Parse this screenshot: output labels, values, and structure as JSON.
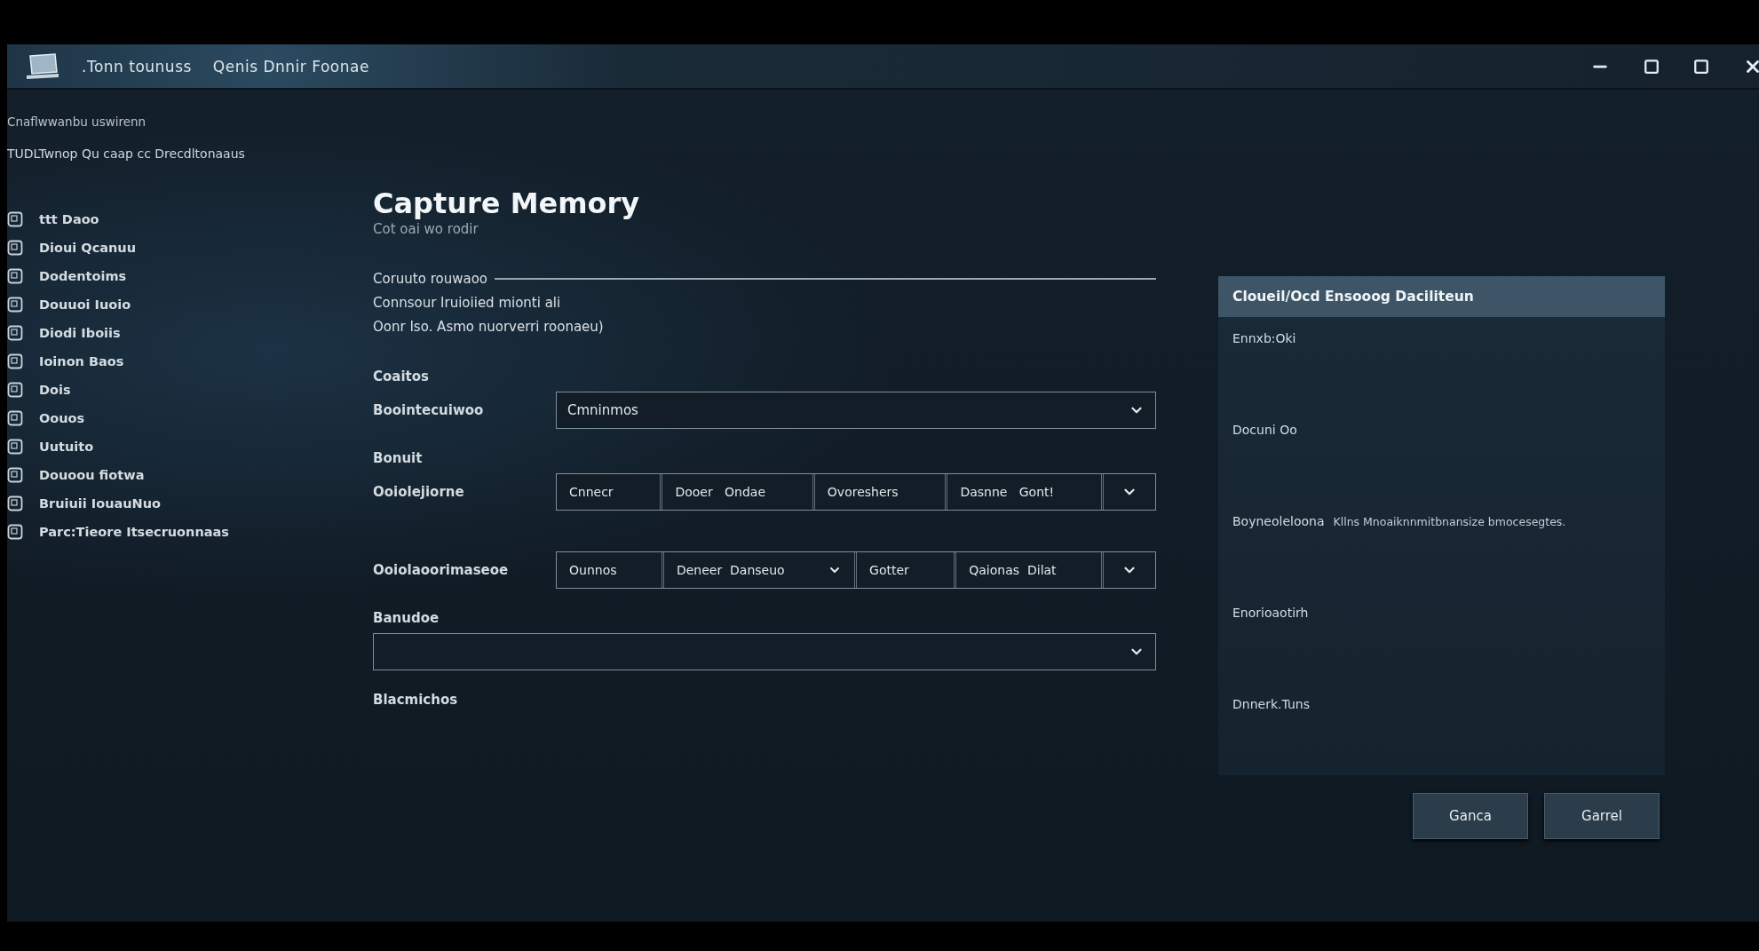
{
  "title_bar": {
    "items": [
      ".Tonn tounuss",
      "Qenis Dnnir Foonae"
    ]
  },
  "sidebar": {
    "breadcrumb": "Cnaflwwanbu uswirenn",
    "subtitle": "TUDLTwnop Qu caap cc Drecdltonaaus",
    "items": [
      {
        "label": "ttt Daoo"
      },
      {
        "label": "Dioui  Qcanuu"
      },
      {
        "label": "Dodentoims"
      },
      {
        "label": "Douuoi Iuoio"
      },
      {
        "label": "Diodi Iboiis"
      },
      {
        "label": "Ioinon Baos"
      },
      {
        "label": "Dois"
      },
      {
        "label": "Oouos"
      },
      {
        "label": "Uutuito"
      },
      {
        "label": "Douoou fiotwa"
      },
      {
        "label": "Bruiuii IouauNuo"
      },
      {
        "label": "Parc:Tieore Itsecruonnaas"
      }
    ]
  },
  "main": {
    "title": "Capture Memory",
    "subtitle": "Cot oai wo rodir",
    "section_heading": "Coruuto rouwaoo",
    "description": [
      "Connsour Iruioiied mionti ali",
      "Oonr Iso. Asmo nuorverri roonaeu)"
    ],
    "groups": [
      {
        "label": "Coaitos",
        "fields": [
          {
            "kind": "select",
            "label": "Boointecuiwoo",
            "value": "Cmninmos"
          }
        ]
      },
      {
        "label": "Bonuit",
        "fields": [
          {
            "kind": "segments",
            "label": "Ooiolejiorne",
            "segments": [
              {
                "text": "Cnnecr",
                "caret": false
              },
              {
                "text": "Dooer   Ondae",
                "caret": false
              },
              {
                "text": "Ovoreshers",
                "caret": false
              },
              {
                "text": "Dasnne   Gont!",
                "caret": false
              }
            ]
          },
          {
            "kind": "segments",
            "label": "Ooiolaoorimaseoe",
            "segments": [
              {
                "text": "Ounnos",
                "caret": false
              },
              {
                "text": "Deneer  Danseuo",
                "caret": true
              },
              {
                "text": "Gotter",
                "caret": false
              },
              {
                "text": "Qaionas  Dilat",
                "caret": false
              }
            ]
          }
        ]
      },
      {
        "label": "Banudoe",
        "fields": [
          {
            "kind": "select"
          }
        ]
      }
    ],
    "footer_label": "Blacmichos"
  },
  "panel": {
    "header": "Cloueil/Ocd Ensooog Daciliteun",
    "rows": [
      {
        "label": "Ennxb:Oki"
      },
      {
        "label": "Docuni Oo"
      },
      {
        "label": "Boyneoleloona",
        "value": "Kllns Mnoaiknnmitbnansize bmocesegtes."
      },
      {
        "label": "Enorioaotirh"
      },
      {
        "label": "Dnnerk.Tuns"
      }
    ]
  },
  "buttons": [
    "Ganca",
    "Garrel"
  ]
}
